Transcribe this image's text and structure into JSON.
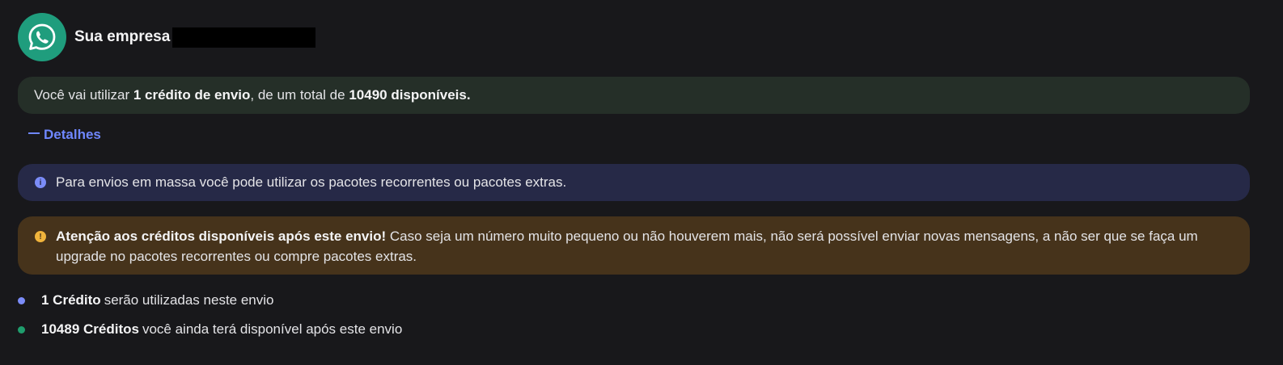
{
  "header": {
    "company_label": "Sua empresa",
    "avatar_icon": "whatsapp-icon",
    "avatar_color": "#1f9d7d"
  },
  "credit_banner": {
    "prefix": "Você vai utilizar",
    "credit_amount": "1 crédito de envio",
    "middle": ", de um total de",
    "total_available": "10490 disponíveis",
    "suffix": "."
  },
  "details_toggle": {
    "label": "Detalhes",
    "icon": "minus-icon",
    "color": "#6f87ff"
  },
  "info_banner": {
    "icon": "info-icon",
    "text": "Para envios em massa você pode utilizar os pacotes recorrentes ou pacotes extras."
  },
  "warning_banner": {
    "icon": "warning-icon",
    "title": "Atenção aos créditos disponíveis após este envio!",
    "text": "Caso seja um número muito pequeno ou não houverem mais, não será possível enviar novas mensagens, a não ser que se faça um upgrade no pacotes recorrentes ou compre pacotes extras."
  },
  "summary": [
    {
      "value": "1 Crédito",
      "text": "serão utilizadas neste envio",
      "dot_color": "#7b8cf8"
    },
    {
      "value": "10489 Créditos",
      "text": "você ainda terá disponível após este envio",
      "dot_color": "#1f9d6d"
    }
  ]
}
